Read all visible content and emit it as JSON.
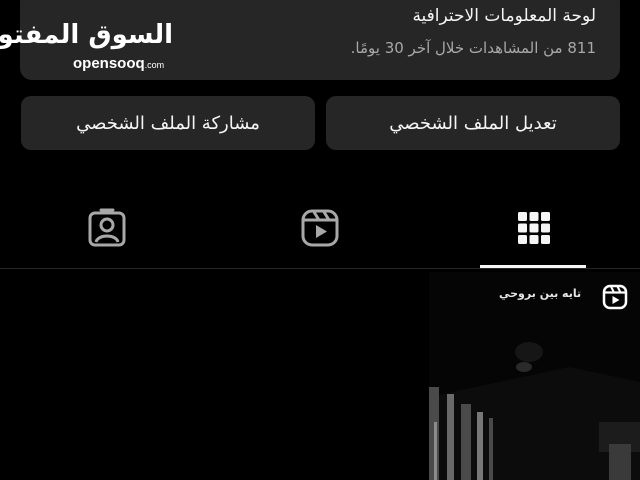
{
  "dashboard": {
    "title": "لوحة المعلومات الاحترافية",
    "subtitle": "811 من المشاهدات خلال آخر 30 يومًا."
  },
  "watermark": {
    "arabic": "السوق المفتوح",
    "latin": "opensooq",
    "suffix": ".com"
  },
  "buttons": {
    "edit_profile": "تعديل الملف الشخصي",
    "share_profile": "مشاركة الملف الشخصي"
  },
  "tabs": [
    {
      "icon": "grid-icon",
      "active": true
    },
    {
      "icon": "reels-icon",
      "active": false
    },
    {
      "icon": "tagged-icon",
      "active": false
    }
  ],
  "posts": [
    {
      "caption": "تايه بين بروحي",
      "type": "reel"
    }
  ],
  "colors": {
    "background": "#000000",
    "card": "#262626",
    "text": "#f5f5f5",
    "secondary_text": "#a8a8a8"
  }
}
